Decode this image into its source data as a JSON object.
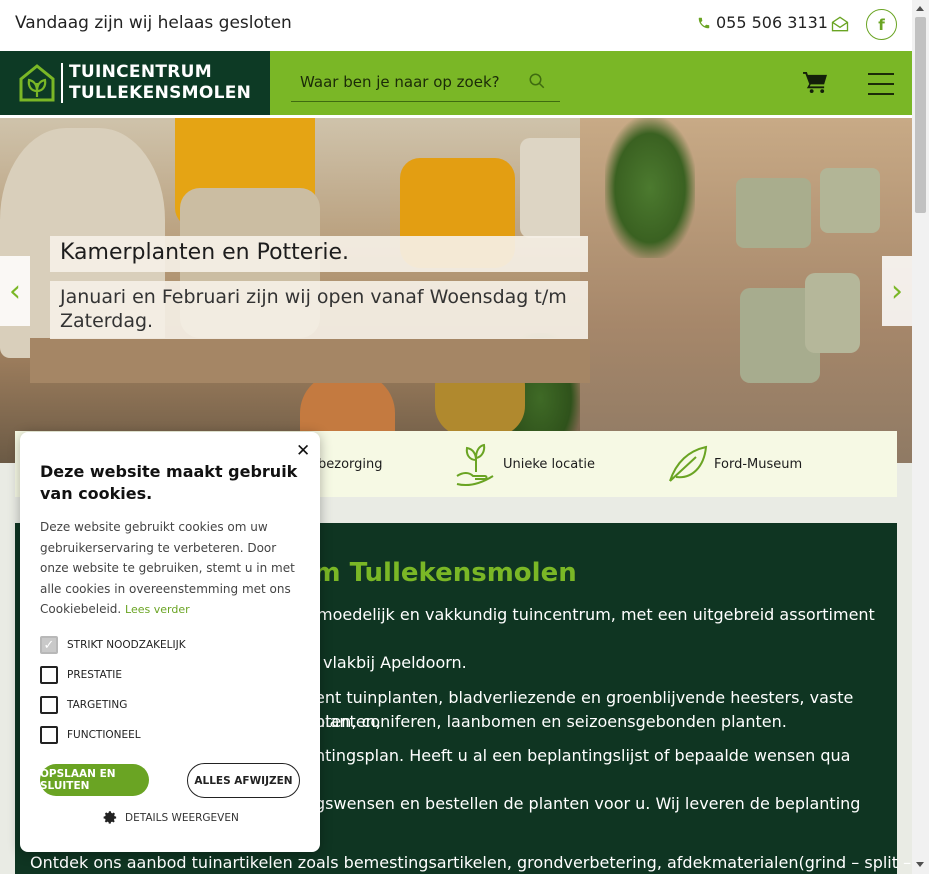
{
  "topbar": {
    "closed_text": "Vandaag zijn wij helaas gesloten",
    "phone": "055 506 3131",
    "facebook_glyph": "f"
  },
  "header": {
    "logo_line1": "TUINCENTRUM",
    "logo_line2": "TULLEKENSMOLEN",
    "search_placeholder": "Waar ben je naar op zoek?"
  },
  "hero": {
    "title": "Kamerplanten en Potterie.",
    "subtitle": "Januari en Februari zijn wij open vanaf Woensdag t/m Zaterdag.",
    "prev_glyph": "‹",
    "next_glyph": "›"
  },
  "usps": [
    {
      "label": "bezorging",
      "icon": "delivery-icon"
    },
    {
      "label": "Unieke locatie",
      "icon": "plant-hand-icon"
    },
    {
      "label": "Ford-Museum",
      "icon": "leaf-icon"
    }
  ],
  "content": {
    "heading": "um Tullekensmolen",
    "paragraphs": [
      "moedelijk en vakkundig tuincentrum, met een uitgebreid assortiment",
      "vlakbij Apeldoorn.",
      "ent tuinplanten, bladverliezende en groenblijvende heesters, vaste planten,",
      "nten, coniferen, laanbomen en seizoensgebonden planten.",
      "ntingsplan. Heeft u al een beplantingslijst of bepaalde wensen qua",
      "gswensen en bestellen de planten voor u. Wij leveren de beplanting",
      "Ontdek ons aanbod tuinartikelen zoals bemestingsartikelen, grondverbetering, afdekmaterialen(grind – split –"
    ]
  },
  "cookie": {
    "close_glyph": "✕",
    "title": "Deze website maakt gebruik van cookies.",
    "description": "Deze website gebruikt cookies om uw gebruikerservaring te verbeteren. Door onze website te gebruiken, stemt u in met alle cookies in overeenstemming met ons Cookiebeleid.",
    "read_more": "Lees verder",
    "options": [
      {
        "label": "STRIKT NOODZAKELIJK",
        "checked": true
      },
      {
        "label": "PRESTATIE",
        "checked": false
      },
      {
        "label": "TARGETING",
        "checked": false
      },
      {
        "label": "FUNCTIONEEL",
        "checked": false
      }
    ],
    "save_button": "OPSLAAN EN SLUITEN",
    "reject_button": "ALLES AFWIJZEN",
    "details": "DETAILS WEERGEVEN"
  },
  "colors": {
    "brand_green": "#7ab726",
    "dark_green": "#0d3a25",
    "usp_bg": "#f6f9e4"
  }
}
